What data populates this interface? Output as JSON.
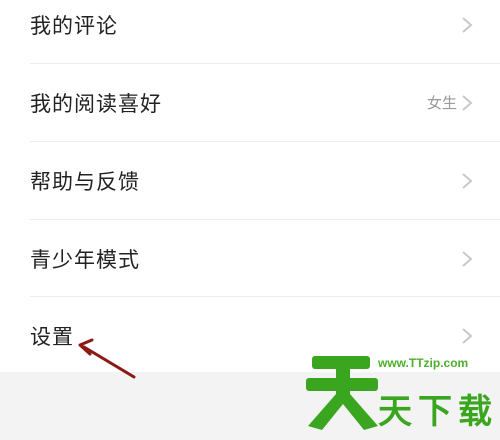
{
  "menu": {
    "items": [
      {
        "label": "我的评论",
        "value": "",
        "icon": "chevron-right-icon"
      },
      {
        "label": "我的阅读喜好",
        "value": "女生",
        "icon": "chevron-right-icon"
      },
      {
        "label": "帮助与反馈",
        "value": "",
        "icon": "chevron-right-icon"
      },
      {
        "label": "青少年模式",
        "value": "",
        "icon": "chevron-right-icon"
      },
      {
        "label": "设置",
        "value": "",
        "icon": "chevron-right-icon"
      }
    ]
  },
  "annotation": {
    "icon": "arrow-pointer-icon",
    "color": "#8b1a14"
  },
  "watermark": {
    "url": "www.TTzip.com",
    "text": "天下载",
    "logo": "天",
    "color": "#3aa61f"
  },
  "colors": {
    "text": "#222222",
    "secondary_text": "#9a9a9a",
    "chevron": "#c8c8c8",
    "divider": "#ececec",
    "footer_background": "#f3f3f3"
  }
}
